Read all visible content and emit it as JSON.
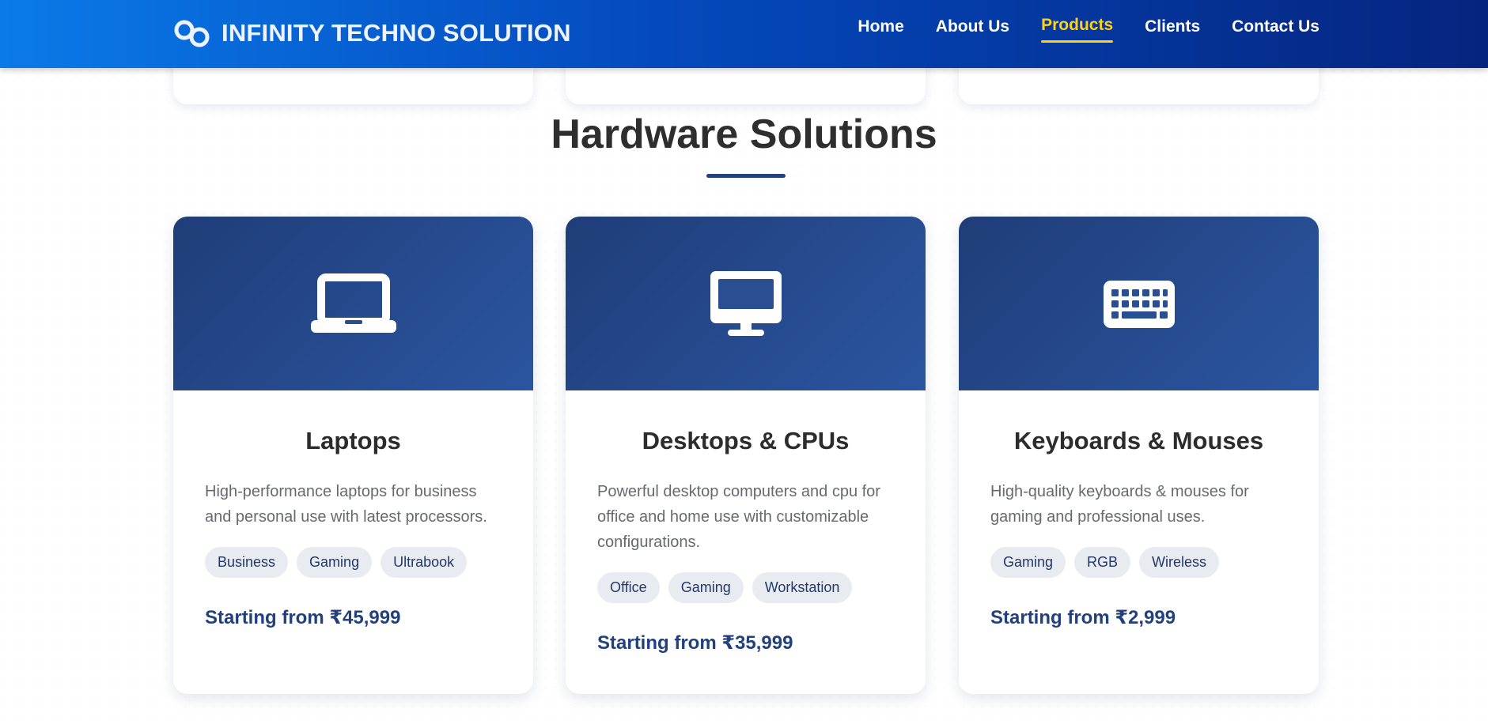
{
  "header": {
    "brand_name": "INFINITY TECHNO SOLUTION",
    "logo_icon": "infinity-logo-icon",
    "nav": [
      {
        "label": "Home",
        "active": false
      },
      {
        "label": "About Us",
        "active": false
      },
      {
        "label": "Products",
        "active": true
      },
      {
        "label": "Clients",
        "active": false
      },
      {
        "label": "Contact Us",
        "active": false
      }
    ]
  },
  "section": {
    "title": "Hardware Solutions"
  },
  "products": [
    {
      "icon": "laptop-icon",
      "title": "Laptops",
      "description": "High-performance laptops for business and personal use with latest processors.",
      "tags": [
        "Business",
        "Gaming",
        "Ultrabook"
      ],
      "price": "Starting from ₹45,999"
    },
    {
      "icon": "desktop-icon",
      "title": "Desktops & CPUs",
      "description": "Powerful desktop computers and cpu for office and home use with customizable configurations.",
      "tags": [
        "Office",
        "Gaming",
        "Workstation"
      ],
      "price": "Starting from ₹35,999"
    },
    {
      "icon": "keyboard-icon",
      "title": "Keyboards & Mouses",
      "description": "High-quality keyboards & mouses for gaming and professional uses.",
      "tags": [
        "Gaming",
        "RGB",
        "Wireless"
      ],
      "price": "Starting from ₹2,999"
    }
  ],
  "colors": {
    "header_gradient_start": "#0a7ae8",
    "header_gradient_end": "#05247f",
    "active_nav": "#ffd21a",
    "banner_dark": "#1f3d78",
    "banner_light": "#2b55a0",
    "price_text": "#22407c",
    "tag_bg": "#e8ecf1"
  }
}
